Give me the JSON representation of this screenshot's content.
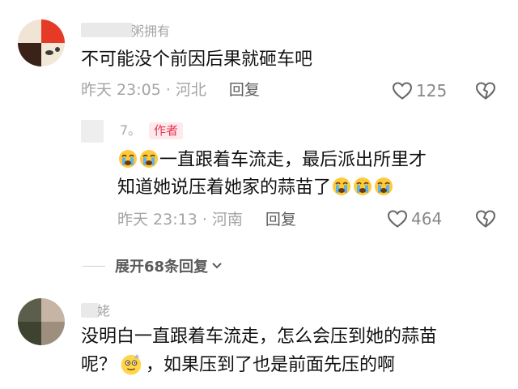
{
  "comments": [
    {
      "username_visible": "粥拥有",
      "text": "不可能没个前因后果就砸车吧",
      "time_location": "昨天 23:05 · 河北",
      "reply_label": "回复",
      "likes": "125",
      "replies": [
        {
          "username_visible": "7。",
          "author_badge": "作者",
          "lines": [
            {
              "before_emoji": [
                "crying-face-emoji",
                "crying-face-emoji"
              ],
              "text": "一直跟着车流走，最后派出所里才"
            },
            {
              "text": "知道她说压着她家的蒜苗了",
              "after_emoji": [
                "crying-face-emoji",
                "crying-face-emoji",
                "crying-face-emoji"
              ]
            }
          ],
          "time_location": "昨天 23:13 · 河南",
          "reply_label": "回复",
          "likes": "464"
        }
      ],
      "expand_label": "展开68条回复"
    },
    {
      "username_visible": "姥",
      "lines": [
        {
          "text": "没明白一直跟着车流走，怎么会压到她的蒜苗"
        },
        {
          "text_before": "呢？",
          "emoji": "dizzy-face-emoji",
          "text_after": "，如果压到了也是前面先压的啊"
        }
      ]
    }
  ],
  "colors": {
    "text_primary": "#111111",
    "text_meta": "#a4a4a4",
    "reply": "#5d5d5d",
    "author_badge_bg": "#ffe9ed",
    "author_badge_text": "#e6374f"
  },
  "icons": {
    "like": "heart-outline-icon",
    "dislike": "broken-heart-icon",
    "expand": "chevron-down-icon"
  }
}
